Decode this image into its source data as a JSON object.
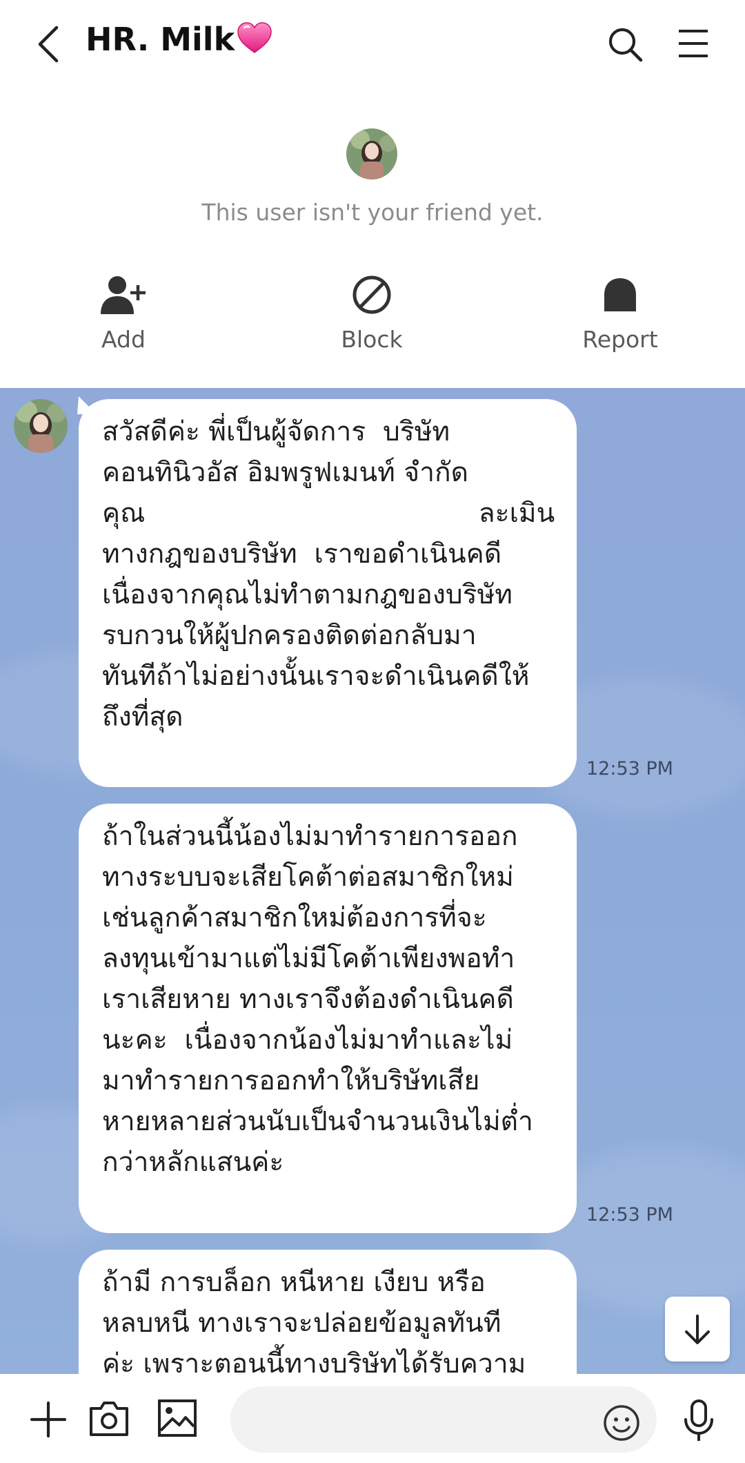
{
  "header": {
    "title": "HR. Milk",
    "title_emoji": "💗"
  },
  "profile": {
    "status": "This user isn't your friend yet.",
    "actions": [
      {
        "label": "Add",
        "icon": "add-friend-icon"
      },
      {
        "label": "Block",
        "icon": "block-icon"
      },
      {
        "label": "Report",
        "icon": "report-icon"
      }
    ]
  },
  "chat": {
    "messages": [
      {
        "text": "สวัสดีค่ะ พี่เป็นผู้จัดการ  บริษัท\nคอนทินิวอัส อิมพรูฟเมนท์ จำกัด\nคุณ                                       ละเมิน\nทางกฎของบริษัท  เราขอดำเนินคดี\nเนื่องจากคุณไม่ทำตามกฎของบริษัท\nรบกวนให้ผู้ปกครองติดต่อกลับมา\nทันทีถ้าไม่อย่างนั้นเราจะดำเนินคดีให้\nถึงที่สุด",
        "time": "12:53 PM"
      },
      {
        "text": "ถ้าในส่วนนี้น้องไม่มาทำรายการออก\nทางระบบจะเสียโคต้าต่อสมาชิกใหม่\nเช่นลูกค้าสมาชิกใหม่ต้องการที่จะ\nลงทุนเข้ามาแต่ไม่มีโคต้าเพียงพอทำ\nเราเสียหาย ทางเราจึงต้องดำเนินคดี\nนะคะ  เนื่องจากน้องไม่มาทำและไม่\nมาทำรายการออกทำให้บริษัทเสีย\nหายหลายส่วนนับเป็นจำนวนเงินไม่ต่ำ\nกว่าหลักแสนค่ะ",
        "time": "12:53 PM"
      },
      {
        "text": "ถ้ามี การบล็อก หนีหาย เงียบ หรือ\nหลบหนี ทางเราจะปล่อยข้อมูลทันที\nค่ะ เพราะตอนนี้ทางบริษัทได้รับความ",
        "time": ""
      }
    ]
  },
  "composer": {
    "placeholder": ""
  },
  "colors": {
    "chat_background": "#8fa9d9",
    "bubble": "#ffffff",
    "header_text": "#111111"
  }
}
